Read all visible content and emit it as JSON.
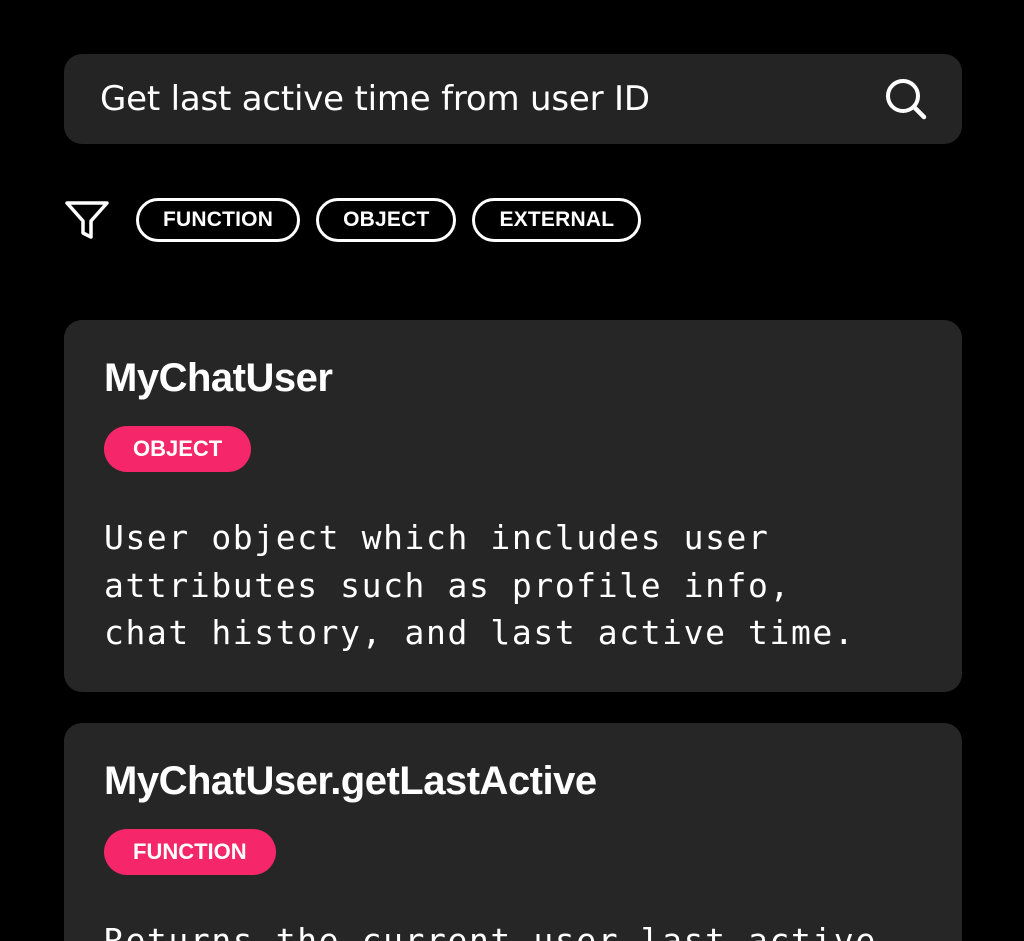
{
  "search": {
    "value": "Get last active time from user ID",
    "icon": "search-icon"
  },
  "filters": {
    "icon": "filter-icon",
    "chips": [
      "FUNCTION",
      "OBJECT",
      "EXTERNAL"
    ]
  },
  "results": [
    {
      "title": "MyChatUser",
      "badge": "OBJECT",
      "description": "User object which includes user\nattributes such as profile info,\nchat history, and last active time."
    },
    {
      "title": "MyChatUser.getLastActive",
      "badge": "FUNCTION",
      "description": "Returns the current user last active"
    }
  ],
  "colors": {
    "background": "#000000",
    "card": "#262626",
    "search_bg": "#242424",
    "accent": "#f5266a",
    "text": "#ffffff"
  }
}
